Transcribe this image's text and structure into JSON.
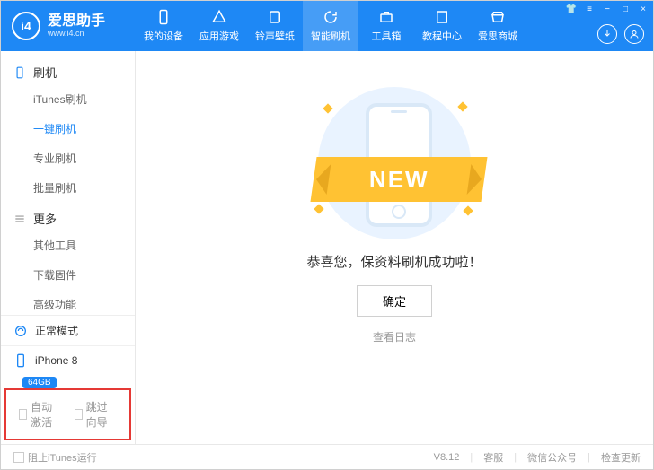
{
  "logo": {
    "icon_text": "i4",
    "title": "爱思助手",
    "subtitle": "www.i4.cn"
  },
  "nav": [
    {
      "label": "我的设备",
      "icon": "phone"
    },
    {
      "label": "应用游戏",
      "icon": "apps"
    },
    {
      "label": "铃声壁纸",
      "icon": "music"
    },
    {
      "label": "智能刷机",
      "icon": "refresh",
      "active": true
    },
    {
      "label": "工具箱",
      "icon": "toolbox"
    },
    {
      "label": "教程中心",
      "icon": "book"
    },
    {
      "label": "爱思商城",
      "icon": "store"
    }
  ],
  "sidebar": {
    "group1": {
      "title": "刷机",
      "items": [
        "iTunes刷机",
        "一键刷机",
        "专业刷机",
        "批量刷机"
      ],
      "active_index": 1
    },
    "group2": {
      "title": "更多",
      "items": [
        "其他工具",
        "下载固件",
        "高级功能"
      ]
    },
    "status": "正常模式",
    "device": {
      "name": "iPhone 8",
      "capacity": "64GB"
    },
    "checks": [
      "自动激活",
      "跳过向导"
    ]
  },
  "main": {
    "ribbon": "NEW",
    "message": "恭喜您，保资料刷机成功啦！",
    "ok_button": "确定",
    "log_link": "查看日志"
  },
  "footer": {
    "block_itunes": "阻止iTunes运行",
    "version": "V8.12",
    "links": [
      "客服",
      "微信公众号",
      "检查更新"
    ]
  }
}
